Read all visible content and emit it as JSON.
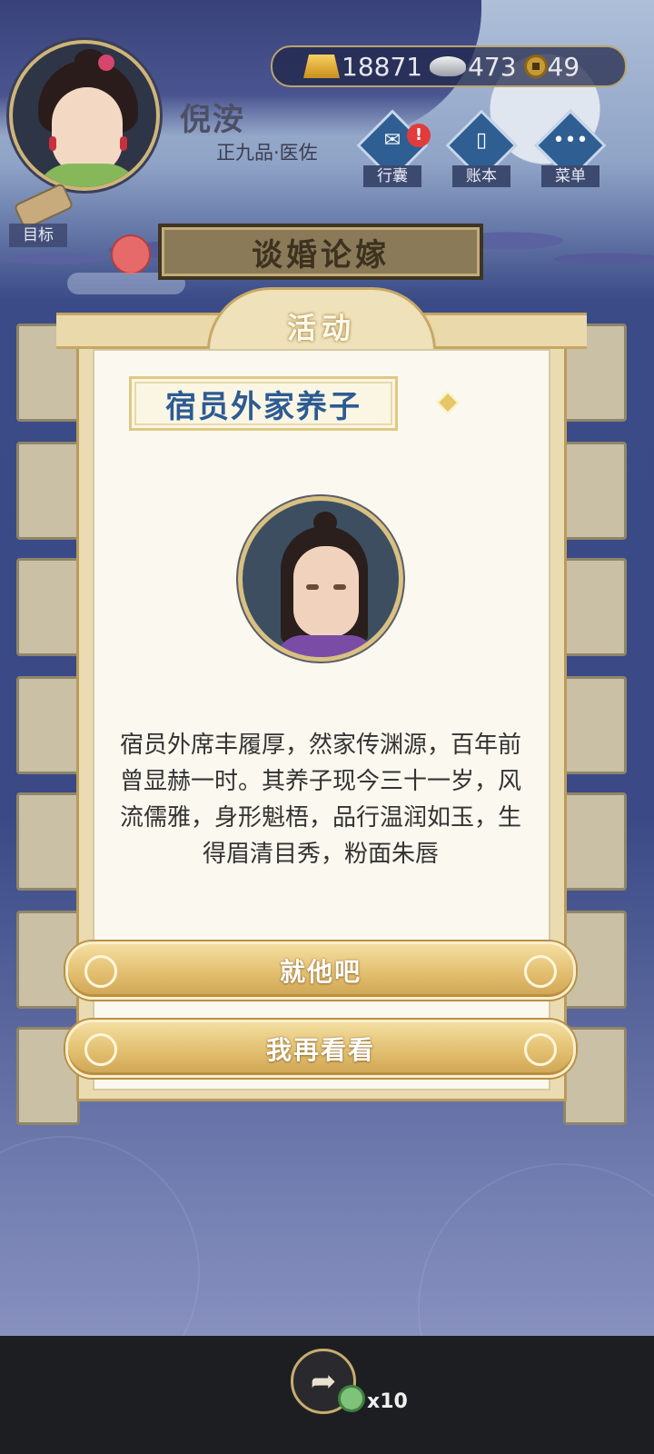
{
  "player": {
    "name": "倪洝",
    "title": "正九品·医佐"
  },
  "currency": {
    "gold": "18871",
    "silver": "473",
    "coins": "49"
  },
  "top_menu": [
    {
      "label": "行囊",
      "icon": "bag-icon",
      "alert": "!"
    },
    {
      "label": "账本",
      "icon": "ledger-icon"
    },
    {
      "label": "菜单",
      "icon": "menu-dots-icon"
    }
  ],
  "goal": {
    "label": "目标"
  },
  "header": {
    "title": "谈婚论嫁"
  },
  "modal": {
    "title": "活动",
    "candidate_name": "宿员外家养子",
    "description": "宿员外席丰履厚，然家传渊源，百年前曾显赫一时。其养子现今三十一岁，风流儒雅，身形魁梧，品行温润如玉，生得眉清目秀，粉面朱唇",
    "accept_label": "就他吧",
    "decline_label": "我再看看"
  },
  "bottom": {
    "share_icon": "share-icon",
    "reward_count": "x10"
  },
  "colors": {
    "name_blue": "#2d5b93",
    "gold_button": "#e2bf6f",
    "background": "#3b4a86"
  }
}
